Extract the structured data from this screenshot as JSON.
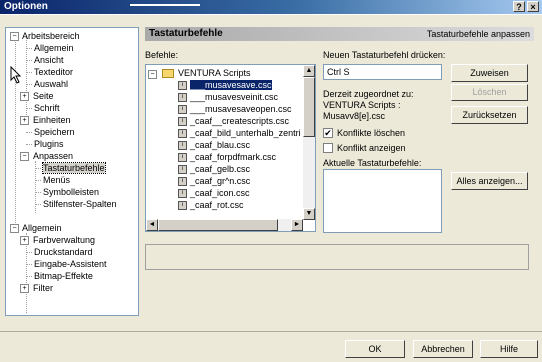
{
  "window": {
    "title": "Optionen",
    "help_btn": "?",
    "close_btn": "×"
  },
  "tree": {
    "items": [
      {
        "label": "Arbeitsbereich",
        "expander": "−"
      },
      {
        "label": "Allgemein"
      },
      {
        "label": "Ansicht"
      },
      {
        "label": "Texteditor"
      },
      {
        "label": "Auswahl"
      },
      {
        "label": "Seite",
        "expander": "+"
      },
      {
        "label": "Schrift"
      },
      {
        "label": "Einheiten",
        "expander": "+"
      },
      {
        "label": "Speichern"
      },
      {
        "label": "Plugins"
      },
      {
        "label": "Anpassen",
        "expander": "−"
      },
      {
        "label": "Tastaturbefehle"
      },
      {
        "label": "Menüs"
      },
      {
        "label": "Symbolleisten"
      },
      {
        "label": "Stilfenster-Spalten"
      },
      {
        "label": "Allgemein",
        "expander": "−"
      },
      {
        "label": "Farbverwaltung",
        "expander": "+"
      },
      {
        "label": "Druckstandard"
      },
      {
        "label": "Eingabe-Assistent"
      },
      {
        "label": "Bitmap-Effekte"
      },
      {
        "label": "Filter",
        "expander": "+"
      }
    ]
  },
  "panel": {
    "header_title": "Tastaturbefehle",
    "header_right": "Tastaturbefehle anpassen",
    "befehle_label": "Befehle:",
    "folder_label": "VENTURA Scripts",
    "folder_expander": "−",
    "commands": [
      "___musavesave.csc",
      "___musavesveinit.csc",
      "___musavesaveopen.csc",
      "_caaf__createscripts.csc",
      "_caaf_bild_unterhalb_zentri",
      "_caaf_blau.csc",
      "_caaf_forpdfmark.csc",
      "_caaf_gelb.csc",
      "_caaf_gr^n.csc",
      "_caaf_icon.csc",
      "_caaf_rot.csc"
    ],
    "new_shortcut_label": "Neuen Tastaturbefehl drücken:",
    "new_shortcut_value": "Ctrl S",
    "assign_btn": "Zuweisen",
    "delete_btn": "Löschen",
    "assigned_label": "Derzeit zugeordnet zu:",
    "assigned_line1": "VENTURA Scripts :",
    "assigned_line2": "Musavv8[e].csc",
    "reset_btn": "Zurücksetzen",
    "chk_conflict_delete": "Konflikte löschen",
    "chk_conflict_delete_checked": "✔",
    "chk_conflict_show": "Konflikt anzeigen",
    "current_label": "Aktuelle Tastaturbefehle:",
    "show_all_btn": "Alles anzeigen..."
  },
  "footer": {
    "ok": "OK",
    "cancel": "Abbrechen",
    "help": "Hilfe"
  },
  "scroll": {
    "up": "▲",
    "down": "▼",
    "left": "◄",
    "right": "►"
  }
}
